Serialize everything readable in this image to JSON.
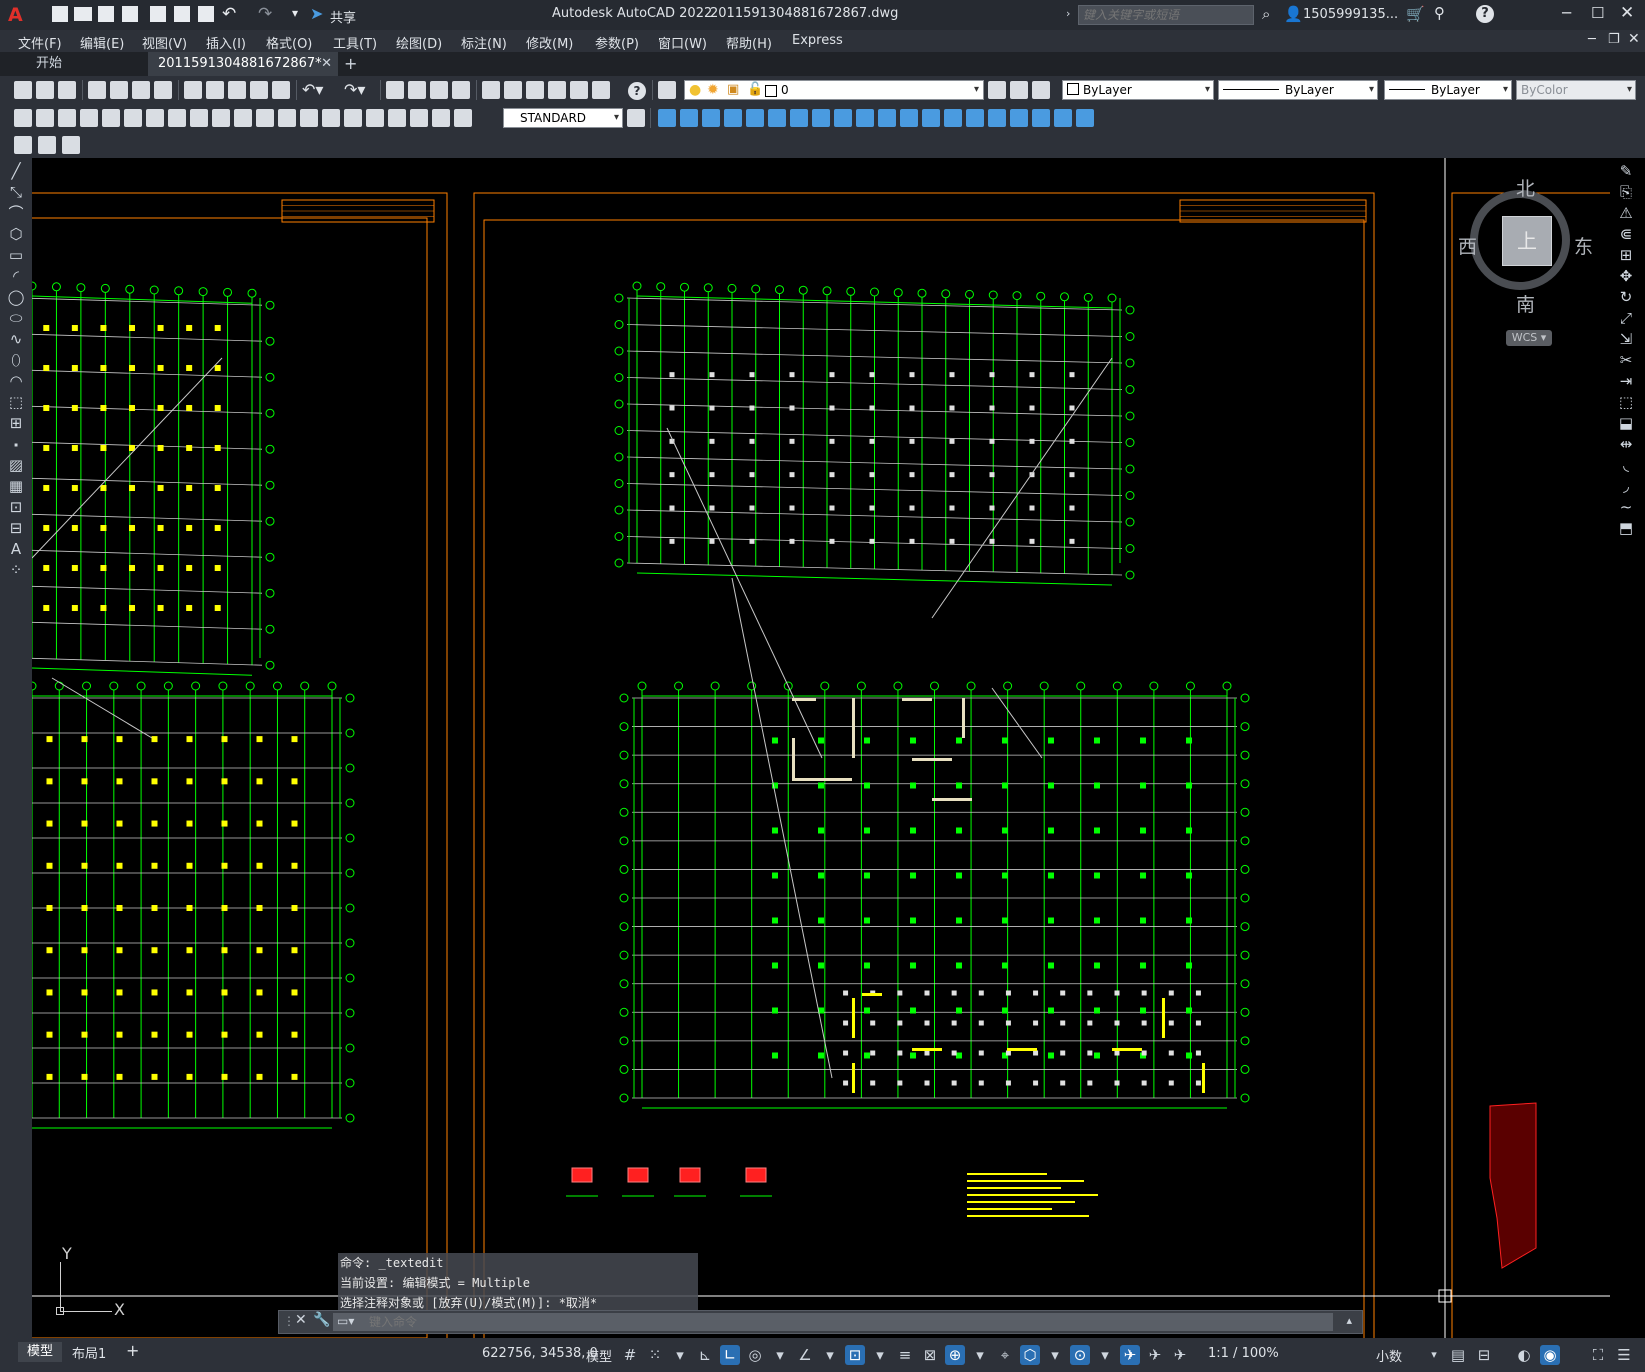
{
  "titlebar": {
    "app_title": "Autodesk AutoCAD 2022",
    "file_name": "2011591304881672867.dwg",
    "share_label": "共享",
    "search_placeholder": "键入关键字或短语",
    "user_name": "1505999135...",
    "window_buttons": [
      "minimize",
      "maximize",
      "close"
    ]
  },
  "menubar": {
    "items": [
      "文件(F)",
      "编辑(E)",
      "视图(V)",
      "插入(I)",
      "格式(O)",
      "工具(T)",
      "绘图(D)",
      "标注(N)",
      "修改(M)",
      "参数(P)",
      "窗口(W)",
      "帮助(H)",
      "Express"
    ]
  },
  "tabs": {
    "start_label": "开始",
    "active_file_label": "2011591304881672867*",
    "add_label": "+"
  },
  "toolbar": {
    "layer_value": "0",
    "color_value": "ByLayer",
    "linetype_value": "ByLayer",
    "lineweight_value": "ByLayer",
    "plotstyle_value": "ByColor",
    "textstyle_value": "STANDARD"
  },
  "viewcube": {
    "north": "北",
    "south": "南",
    "east": "东",
    "west": "西",
    "top_face": "上",
    "wcs_label": "WCS"
  },
  "ucs": {
    "x_label": "X",
    "y_label": "Y"
  },
  "command": {
    "history": [
      "命令: _textedit",
      "当前设置: 编辑模式 = Multiple",
      "选择注释对象或 [放弃(U)/模式(M)]: *取消*"
    ],
    "input_placeholder": "键入命令"
  },
  "statusbar": {
    "model_tab": "模型",
    "layout_tab": "布局1",
    "add_layout": "+",
    "coordinates": "622756, 34538, 0",
    "model_space": "模型",
    "scale": "1:1 / 100%",
    "units": "小数"
  },
  "colors": {
    "accent": "#2a6fb3",
    "frame_orange": "#ff7f00",
    "grid_green": "#00ff00",
    "column_yellow": "#ffff00",
    "axis_gray": "#c8c8c8"
  }
}
